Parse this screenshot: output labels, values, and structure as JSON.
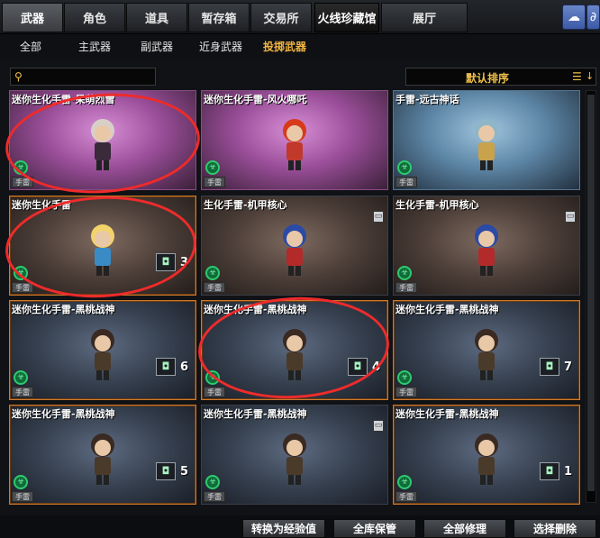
{
  "tabs": [
    {
      "label": "武器",
      "active": true
    },
    {
      "label": "角色"
    },
    {
      "label": "道具"
    },
    {
      "label": "暂存箱"
    },
    {
      "label": "交易所"
    },
    {
      "label": "火线珍藏馆"
    },
    {
      "label": "展厅"
    }
  ],
  "subtabs": [
    {
      "label": "全部"
    },
    {
      "label": "主武器"
    },
    {
      "label": "副武器"
    },
    {
      "label": "近身武器"
    },
    {
      "label": "投掷武器",
      "active": true
    }
  ],
  "search": {
    "value": "",
    "placeholder": ""
  },
  "sort": {
    "label": "默认排序"
  },
  "items": [
    {
      "title": "迷你生化手雷-呆萌烈雪",
      "bg": "pink",
      "tag": "手雷",
      "count": "",
      "trash": false
    },
    {
      "title": "迷你生化手雷-风火哪吒",
      "bg": "pink",
      "tag": "手雷",
      "count": "",
      "trash": false
    },
    {
      "title": "手雷-远古神话",
      "bg": "blue",
      "tag": "手雷",
      "count": "",
      "trash": false
    },
    {
      "title": "迷你生化手雷",
      "bg": "brown",
      "tag": "手雷",
      "count": "3",
      "trash": false,
      "orange": true
    },
    {
      "title": "生化手雷-机甲核心",
      "bg": "brown",
      "tag": "手雷",
      "count": "",
      "trash": true
    },
    {
      "title": "生化手雷-机甲核心",
      "bg": "brown",
      "tag": "手雷",
      "count": "",
      "trash": true
    },
    {
      "title": "迷你生化手雷-黑桃战神",
      "bg": "navy",
      "tag": "手雷",
      "count": "6",
      "trash": false,
      "orange": true
    },
    {
      "title": "迷你生化手雷-黑桃战神",
      "bg": "navy",
      "tag": "手雷",
      "count": "4",
      "trash": false,
      "orange": true
    },
    {
      "title": "迷你生化手雷-黑桃战神",
      "bg": "navy",
      "tag": "手雷",
      "count": "7",
      "trash": false,
      "orange": true
    },
    {
      "title": "迷你生化手雷-黑桃战神",
      "bg": "navy",
      "tag": "手雷",
      "count": "5",
      "trash": false,
      "orange": true
    },
    {
      "title": "迷你生化手雷-黑桃战神",
      "bg": "navy",
      "tag": "手雷",
      "count": "",
      "trash": true
    },
    {
      "title": "迷你生化手雷-黑桃战神",
      "bg": "navy",
      "tag": "手雷",
      "count": "1",
      "trash": false,
      "orange": true
    }
  ],
  "bottom_buttons": [
    {
      "label": "转换为经验值"
    },
    {
      "label": "全库保管"
    },
    {
      "label": "全部修理"
    },
    {
      "label": "选择删除"
    }
  ],
  "colors": {
    "accent": "#f2b441",
    "annotation": "#ee2b2b"
  }
}
